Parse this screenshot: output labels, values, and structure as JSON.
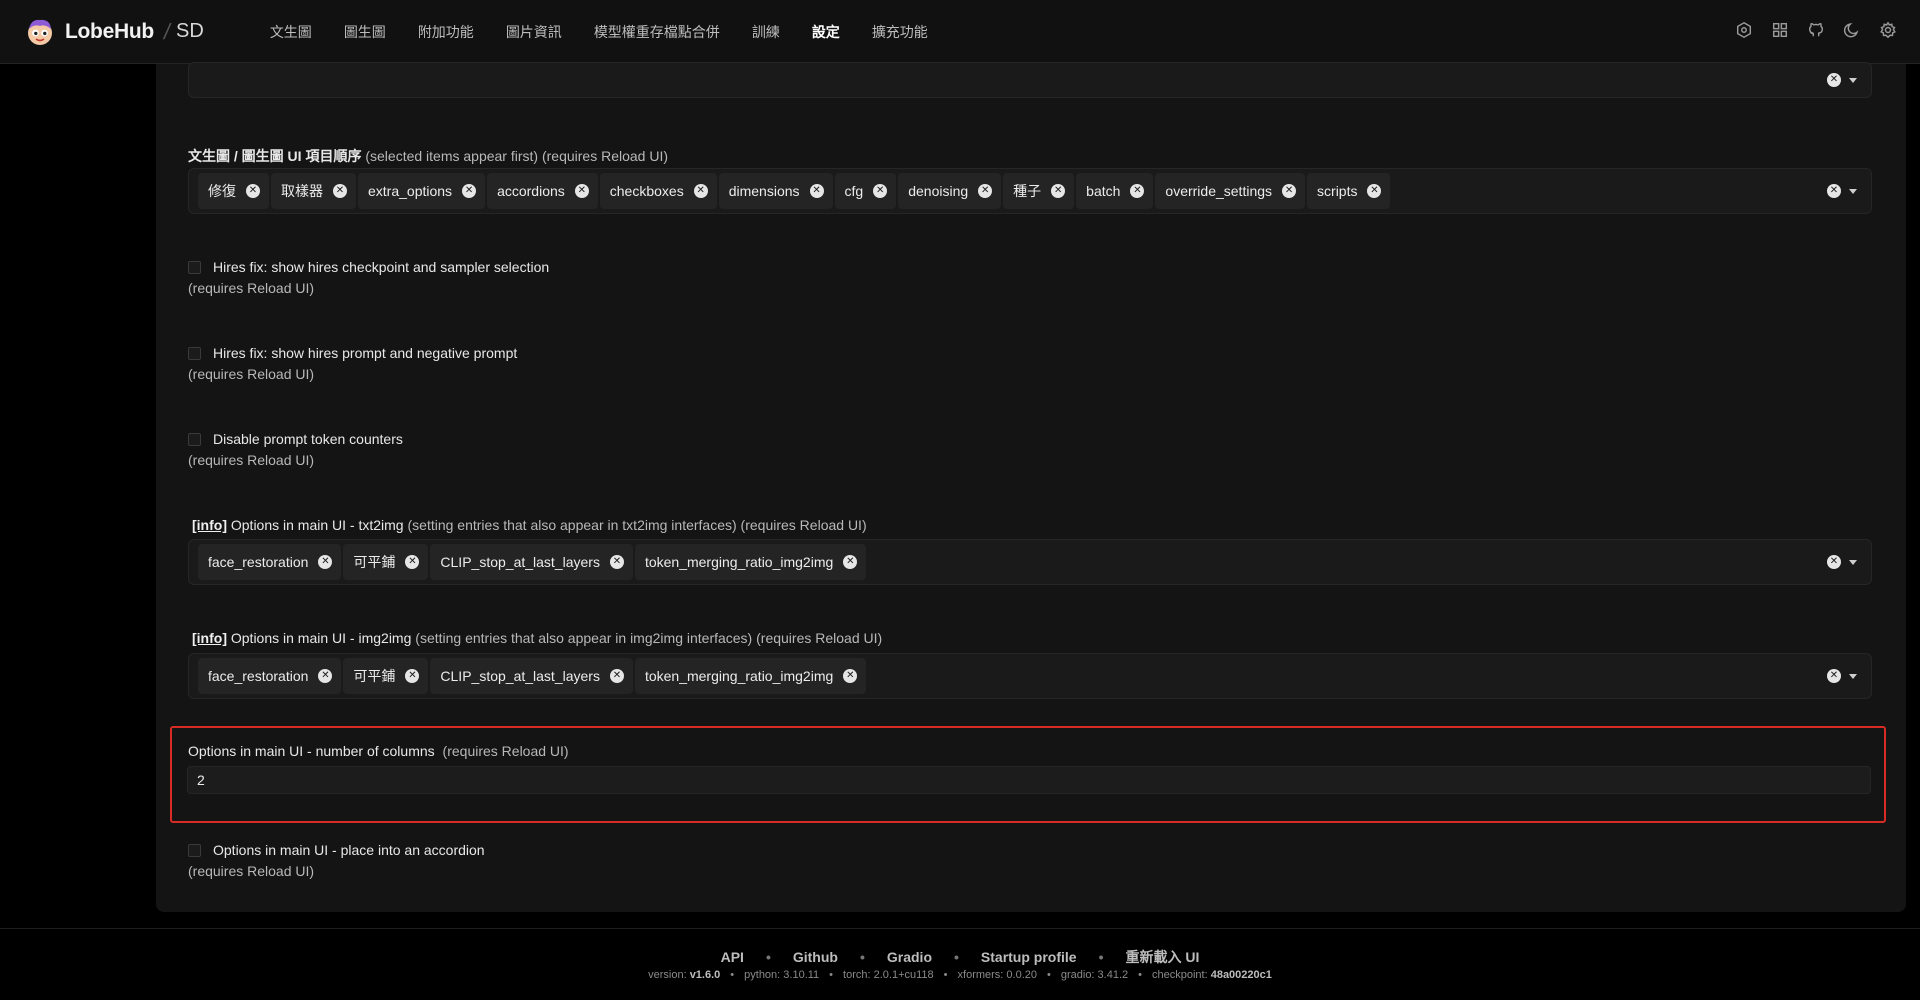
{
  "header": {
    "brand": "LobeHub",
    "brand_sep": "/",
    "brand_sub": "SD",
    "tabs": [
      "文生圖",
      "圖生圖",
      "附加功能",
      "圖片資訊",
      "模型權重存檔點合併",
      "訓練",
      "設定",
      "擴充功能"
    ],
    "active_tab": "設定",
    "icons": [
      "hexagon-icon",
      "grid-icon",
      "github-icon",
      "moon-icon",
      "gear-icon"
    ]
  },
  "settings": {
    "ui_order": {
      "label_main": "文生圖 / 圖生圖 UI 項目順序",
      "label_note": " (selected items appear first) (requires Reload UI)",
      "chips": [
        "修復",
        "取樣器",
        "extra_options",
        "accordions",
        "checkboxes",
        "dimensions",
        "cfg",
        "denoising",
        "種子",
        "batch",
        "override_settings",
        "scripts"
      ]
    },
    "hires_checkpoint": {
      "label": "Hires fix: show hires checkpoint and sampler selection",
      "note": "(requires Reload UI)"
    },
    "hires_prompt": {
      "label": "Hires fix: show hires prompt and negative prompt",
      "note": "(requires Reload UI)"
    },
    "disable_token": {
      "label": "Disable prompt token counters",
      "note": "(requires Reload UI)"
    },
    "txt2img_opts": {
      "info": "[info]",
      "label_main": " Options in main UI - txt2img",
      "label_note": " (setting entries that also appear in txt2img interfaces) (requires Reload UI)",
      "chips": [
        "face_restoration",
        "可平鋪",
        "CLIP_stop_at_last_layers",
        "token_merging_ratio_img2img"
      ]
    },
    "img2img_opts": {
      "info": "[info]",
      "label_main": " Options in main UI - img2img",
      "label_note": " (setting entries that also appear in img2img interfaces) (requires Reload UI)",
      "chips": [
        "face_restoration",
        "可平鋪",
        "CLIP_stop_at_last_layers",
        "token_merging_ratio_img2img"
      ]
    },
    "columns": {
      "label_main": "Options in main UI - number of columns",
      "label_note": " (requires Reload UI)",
      "value": "2"
    },
    "accordion": {
      "label": "Options in main UI - place into an accordion",
      "note": "(requires Reload UI)"
    }
  },
  "footer": {
    "links": [
      "API",
      "Github",
      "Gradio",
      "Startup profile",
      "重新載入 UI"
    ],
    "meta": {
      "version_label": "version: ",
      "version": "v1.6.0",
      "python": "python: 3.10.11",
      "torch": "torch: 2.0.1+cu118",
      "xformers": "xformers: 0.0.20",
      "gradio": "gradio: 3.41.2",
      "checkpoint_label": "checkpoint: ",
      "checkpoint": "48a00220c1"
    }
  },
  "colors": {
    "highlight": "#d92b25"
  }
}
